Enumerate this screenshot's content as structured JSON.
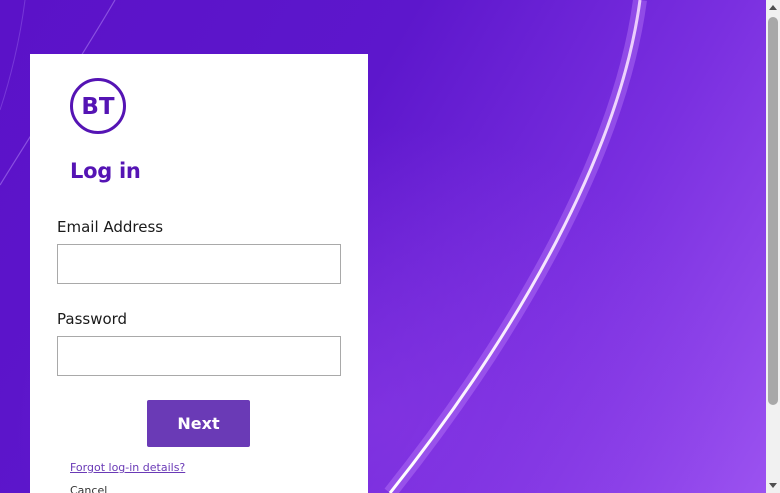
{
  "brand": {
    "logo_text": "BT",
    "color": "#5514b4"
  },
  "form": {
    "title": "Log in",
    "email_label": "Email Address",
    "email_value": "",
    "password_label": "Password",
    "password_value": "",
    "next_label": "Next",
    "forgot_label": "Forgot log-in details?",
    "cancel_label": "Cancel"
  },
  "colors": {
    "background": "#5a14c4",
    "button": "#6a3ab6",
    "link": "#6a3ab6"
  }
}
